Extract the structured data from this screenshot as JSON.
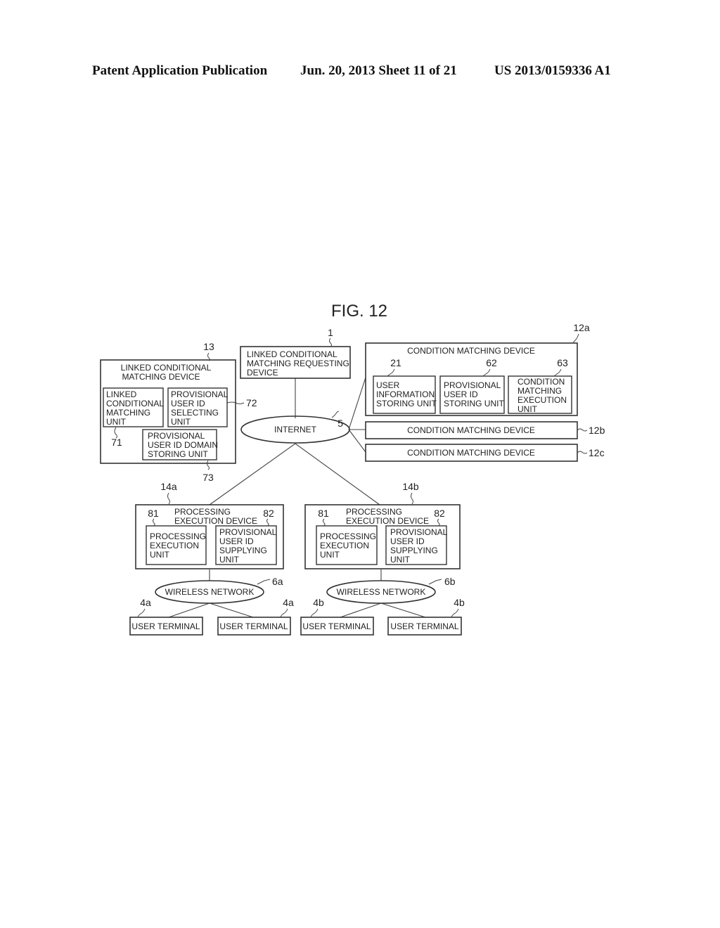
{
  "header": {
    "publication": "Patent Application Publication",
    "date_sheet": "Jun. 20, 2013   Sheet 11 of 21",
    "number": "US 2013/0159336 A1"
  },
  "figure": {
    "title": "FIG. 12",
    "nodes": {
      "linked_device": {
        "ref": "13",
        "label": [
          "LINKED CONDITIONAL",
          "MATCHING DEVICE"
        ],
        "units": {
          "matching_unit": {
            "ref": "71",
            "label": [
              "LINKED",
              "CONDITIONAL",
              "MATCHING",
              "UNIT"
            ]
          },
          "selecting_unit": {
            "ref": "72",
            "label": [
              "PROVISIONAL",
              "USER ID",
              "SELECTING",
              "UNIT"
            ]
          },
          "domain_storing_unit": {
            "ref": "73",
            "label": [
              "PROVISIONAL",
              "USER ID DOMAIN",
              "STORING UNIT"
            ]
          }
        }
      },
      "requesting_device": {
        "ref": "1",
        "label": [
          "LINKED CONDITIONAL",
          "MATCHING REQUESTING",
          "DEVICE"
        ]
      },
      "internet": {
        "ref": "5",
        "label": "INTERNET"
      },
      "cmd_a": {
        "ref": "12a",
        "label": "CONDITION MATCHING DEVICE",
        "units": {
          "user_info": {
            "ref": "21",
            "label": [
              "USER",
              "INFORMATION",
              "STORING UNIT"
            ]
          },
          "prov_id_storing": {
            "ref": "62",
            "label": [
              "PROVISIONAL",
              "USER ID",
              "STORING UNIT"
            ]
          },
          "execution": {
            "ref": "63",
            "label": [
              "CONDITION",
              "MATCHING",
              "EXECUTION",
              "UNIT"
            ]
          }
        }
      },
      "cmd_b": {
        "ref": "12b",
        "label": "CONDITION MATCHING DEVICE"
      },
      "cmd_c": {
        "ref": "12c",
        "label": "CONDITION MATCHING DEVICE"
      },
      "ped_a": {
        "ref": "14a",
        "label": [
          "PROCESSING",
          "EXECUTION DEVICE"
        ],
        "units": {
          "exec_unit": {
            "ref": "81",
            "label": [
              "PROCESSING",
              "EXECUTION",
              "UNIT"
            ]
          },
          "supply_unit": {
            "ref": "82",
            "label": [
              "PROVISIONAL",
              "USER ID",
              "SUPPLYING",
              "UNIT"
            ]
          }
        }
      },
      "ped_b": {
        "ref": "14b",
        "label": [
          "PROCESSING",
          "EXECUTION DEVICE"
        ],
        "units": {
          "exec_unit": {
            "ref": "81",
            "label": [
              "PROCESSING",
              "EXECUTION",
              "UNIT"
            ]
          },
          "supply_unit": {
            "ref": "82",
            "label": [
              "PROVISIONAL",
              "USER ID",
              "SUPPLYING",
              "UNIT"
            ]
          }
        }
      },
      "wireless_a": {
        "ref": "6a",
        "label": "WIRELESS NETWORK"
      },
      "wireless_b": {
        "ref": "6b",
        "label": "WIRELESS NETWORK"
      },
      "terminals": [
        {
          "ref": "4a",
          "label": "USER TERMINAL"
        },
        {
          "ref": "4a",
          "label": "USER TERMINAL"
        },
        {
          "ref": "4b",
          "label": "USER TERMINAL"
        },
        {
          "ref": "4b",
          "label": "USER TERMINAL"
        }
      ]
    }
  }
}
